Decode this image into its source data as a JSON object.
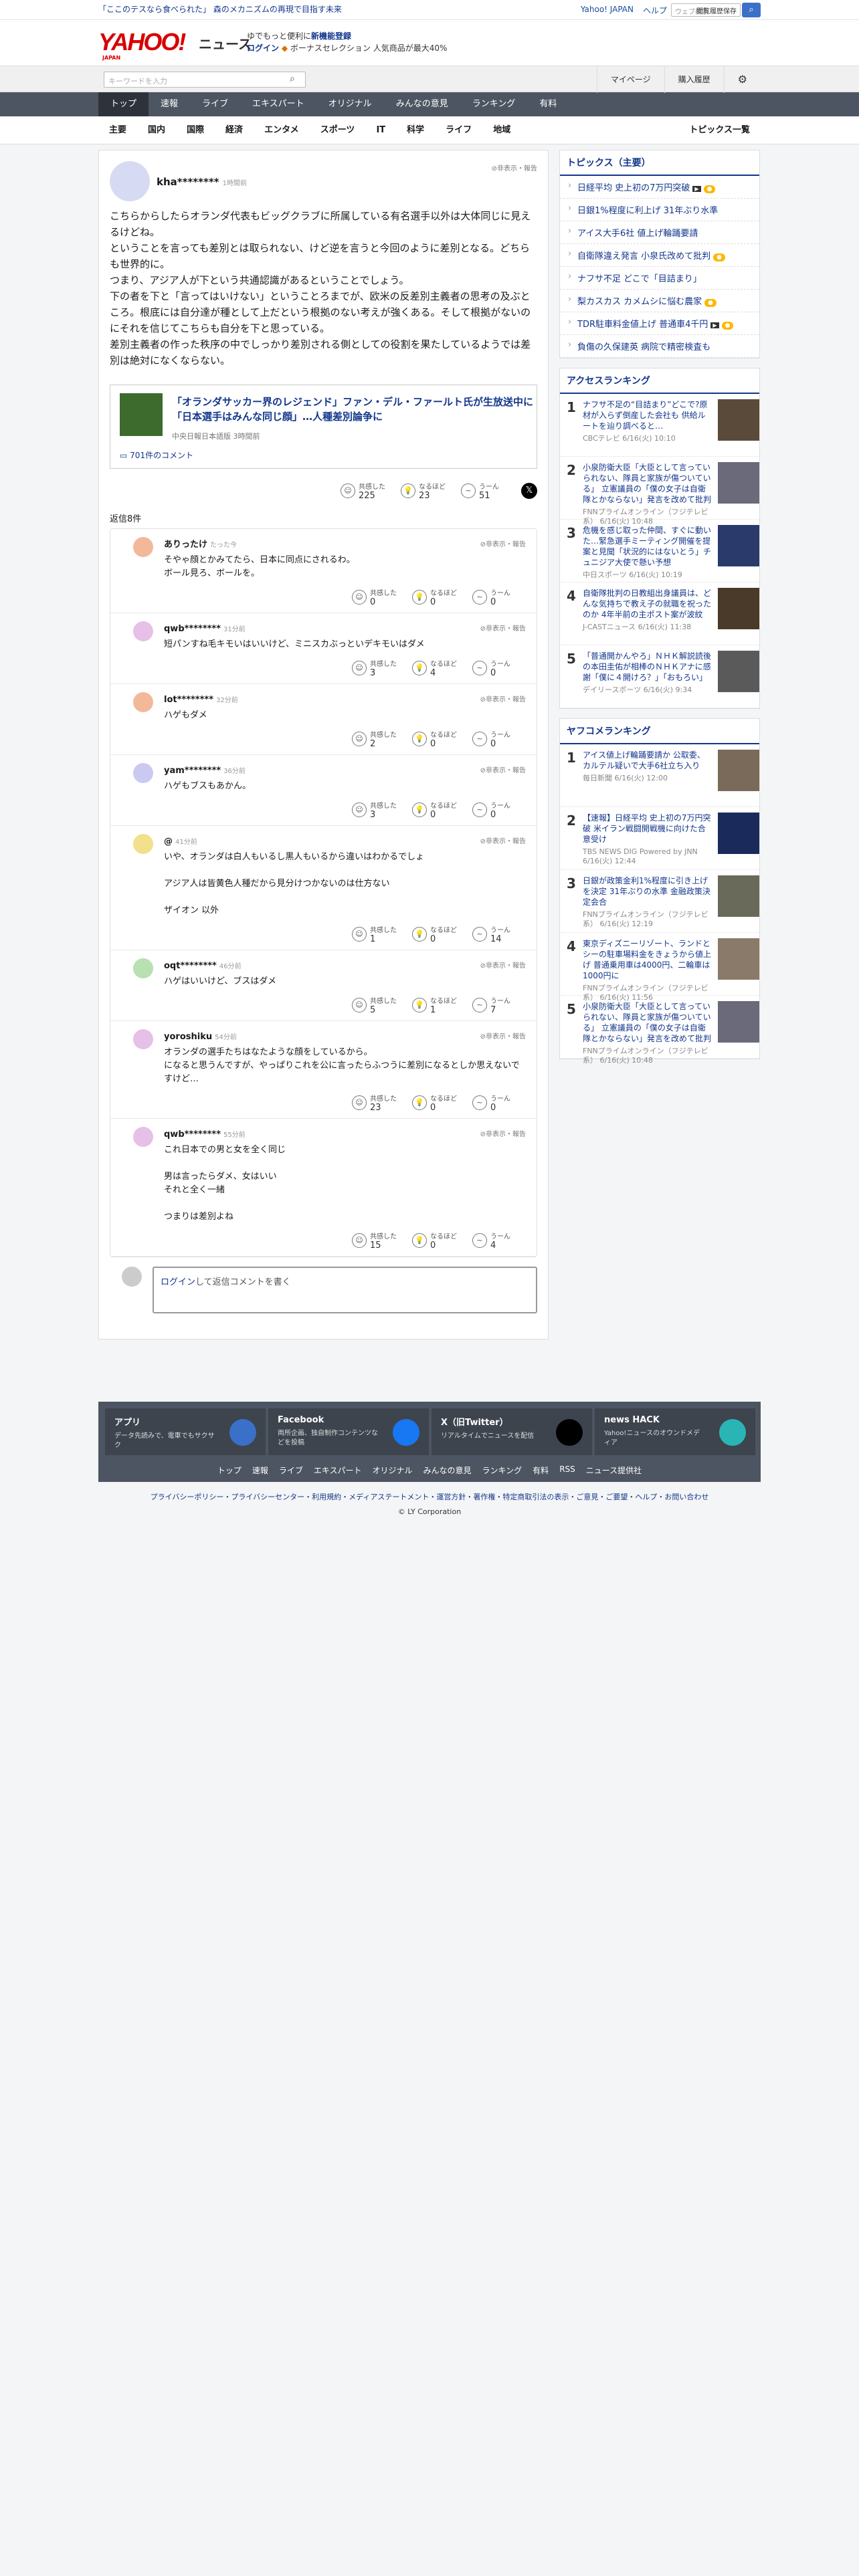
{
  "top": {
    "promo": "「ここのテスなら食べられた」 森のメカニズムの再現で目指す未来",
    "links": [
      "Yahoo! JAPAN",
      "ヘルプ"
    ],
    "search_placeholder": "ウェブ検索",
    "recent_save": "閲覧履歴保存"
  },
  "header": {
    "logo": "YAHOO!",
    "logo_sub": "JAPAN",
    "logo_news": "ニュース",
    "promo_line1": "ゆでもっと便利に",
    "promo_line1_bold": "新機能登録",
    "login": "ログイン",
    "promo_line2": "ボーナスセレクション  人気商品が最大40%"
  },
  "searchbar": {
    "placeholder": "キーワードを入力",
    "mypage": "マイページ",
    "history": "購入履歴"
  },
  "nav1": [
    "トップ",
    "速報",
    "ライブ",
    "エキスパート",
    "オリジナル",
    "みんなの意見",
    "ランキング",
    "有料"
  ],
  "nav2": [
    "主要",
    "国内",
    "国際",
    "経済",
    "エンタメ",
    "スポーツ",
    "IT",
    "科学",
    "ライフ",
    "地域"
  ],
  "nav2_last": "トピックス一覧",
  "comment": {
    "user": "kha********",
    "time": "1時間前",
    "report": "非表示・報告",
    "body": [
      "こちらからしたらオランダ代表もビッグクラブに所属している有名選手以外は大体同じに見えるけどね。",
      "ということを言っても差別とは取られない、けど逆を言うと今回のように差別となる。どちらも世界的に。",
      "つまり、アジア人が下という共通認識があるということでしょう。",
      "下の者を下と「言ってはいけない」ということろまでが、欧米の反差別主義者の思考の及ぶところ。根底には自分達が種として上だという根拠のない考えが強くある。そして根拠がないのにそれを信じてこちらも自分を下と思っている。",
      "差別主義者の作った秩序の中でしっかり差別される側としての役割を果たしているようでは差別は絶対になくならない。"
    ],
    "article_title": "「オランダサッカー界のレジェンド」ファン・デル・ファールト氏が生放送中に「日本選手はみんな同じ顔」…人種差別論争に",
    "article_src": "中央日報日本語版 3時間前",
    "article_comments": "701件のコメント",
    "reactions": [
      {
        "label": "共感した",
        "value": "225",
        "icon": "smile-icon"
      },
      {
        "label": "なるほど",
        "value": "23",
        "icon": "lightbulb-icon"
      },
      {
        "label": "うーん",
        "value": "51",
        "icon": "hmm-icon"
      }
    ],
    "reply_label": "返信8件"
  },
  "replies": [
    {
      "user": "ありったけ",
      "time": "たった今",
      "color": "#f3b89a",
      "lines": [
        "そやゃ顔とかみてたら、日本に同点にされるわ。",
        "ボール見ろ、ボールを。"
      ],
      "r": [
        "0",
        "0",
        "0"
      ]
    },
    {
      "user": "qwb********",
      "time": "31分前",
      "color": "#e6c0e6",
      "lines": [
        "短パンすね毛キモいはいいけど、ミニスカぶっといデキモいはダメ"
      ],
      "r": [
        "3",
        "4",
        "0"
      ]
    },
    {
      "user": "lot********",
      "time": "32分前",
      "color": "#f3b89a",
      "lines": [
        "ハゲもダメ"
      ],
      "r": [
        "2",
        "0",
        "0"
      ]
    },
    {
      "user": "yam********",
      "time": "36分前",
      "color": "#c9c9f2",
      "lines": [
        "ハゲもブスもあかん。"
      ],
      "r": [
        "3",
        "0",
        "0"
      ]
    },
    {
      "user": "@",
      "time": "41分前",
      "color": "#f2e08a",
      "lines": [
        "いや、オランダは白人もいるし黒人もいるから違いはわかるでしょ",
        "",
        "アジア人は皆黄色人種だから見分けつかないのは仕方ない",
        "",
        "ザイオン 以外"
      ],
      "r": [
        "1",
        "0",
        "14"
      ]
    },
    {
      "user": "oqt********",
      "time": "46分前",
      "color": "#b8e0b0",
      "lines": [
        "ハゲはいいけど、ブスはダメ"
      ],
      "r": [
        "5",
        "1",
        "7"
      ]
    },
    {
      "user": "yoroshiku",
      "time": "54分前",
      "color": "#e6c0e6",
      "lines": [
        "オランダの選手たちはなたような顔をしているから。",
        "になると思うんですが、やっぱりこれを公に言ったらふつうに差別になるとしか思えないですけど…"
      ],
      "r": [
        "23",
        "0",
        "0"
      ]
    },
    {
      "user": "qwb********",
      "time": "55分前",
      "color": "#e6c0e6",
      "lines": [
        "これ日本での男と女を全く同じ",
        "",
        "男は言ったらダメ、女はいい",
        "それと全く一緒",
        "",
        "つまりは差別よね"
      ],
      "r": [
        "15",
        "0",
        "4"
      ]
    }
  ],
  "reply_box": {
    "login": "ログイン",
    "text": "して返信コメントを書く"
  },
  "topics": {
    "heading": "トピックス（主要）",
    "items": [
      {
        "t": "日経平均 史上初の7万円突破",
        "v": true,
        "n": true
      },
      {
        "t": "日銀1%程度に利上げ 31年ぶり水準",
        "v": false,
        "n": false
      },
      {
        "t": "アイス大手6社 値上げ輪踊要請",
        "v": false,
        "n": false
      },
      {
        "t": "自衛隊違え発言 小泉氏改めて批判",
        "v": false,
        "n": true
      },
      {
        "t": "ナフサ不足 どこで「目詰まり」",
        "v": false,
        "n": false
      },
      {
        "t": "梨カスカス カメムシに悩む農家",
        "v": false,
        "n": true
      },
      {
        "t": "TDR駐車料金値上げ 普通車4千円",
        "v": true,
        "n": true
      },
      {
        "t": "負傷の久保建英 病院で精密検査も",
        "v": false,
        "n": false
      }
    ]
  },
  "access_ranking": {
    "heading": "アクセスランキング",
    "items": [
      {
        "t": "ナフサ不足の“目詰まり”どこで?原材が入らず倒産した会社も 供給ルートを辿り調べると…",
        "s": "CBCテレビ 6/16(火) 10:10",
        "c": "#5a4a3a"
      },
      {
        "t": "小泉防衛大臣「大臣として言っていられない、隊員と家族が傷ついている」 立憲議員の「僕の女子は自衛隊とかならない」発言を改めて批判",
        "s": "FNNプライムオンライン（フジテレビ系） 6/16(火) 10:48",
        "c": "#6a6a7a"
      },
      {
        "t": "危機を感じ取った仲間、すぐに動いた…緊急選手ミーティング開催を提案と見聞「状況的にはないとう」チュニジア大使で懸い予想",
        "s": "中日スポーツ 6/16(火) 10:19",
        "c": "#2a3a6a"
      },
      {
        "t": "自衛隊批判の日教組出身議員は、どんな気持ちで教え子の就職を祝ったのか 4年半前の主ポスト案が波紋",
        "s": "J-CASTニュース 6/16(火) 11:38",
        "c": "#4a3a2a"
      },
      {
        "t": "「普通開かんやろ」ＮＨＫ解説読後の本田圭佑が相棒のＮＨＫアナに感謝「僕に４開けろ？」「おもろい」",
        "s": "デイリースポーツ 6/16(火) 9:34",
        "c": "#5a5a5a"
      }
    ]
  },
  "yafoko_ranking": {
    "heading": "ヤフコメランキング",
    "items": [
      {
        "t": "アイス値上げ輪踊要請か 公取委、カルテル疑いで大手6社立ち入り",
        "s": "毎日新聞 6/16(火) 12:00",
        "c": "#7a6a5a"
      },
      {
        "t": "【速報】日経平均 史上初の7万円突破 米イラン戦闘開戦機に向けた合意受け",
        "s": "TBS NEWS DIG Powered by JNN 6/16(火) 12:44",
        "c": "#1a2a5a"
      },
      {
        "t": "日銀が政策金利1%程度に引き上げを決定 31年ぶりの水準 金融政策決定会合",
        "s": "FNNプライムオンライン（フジテレビ系） 6/16(火) 12:19",
        "c": "#6a6a5a"
      },
      {
        "t": "東京ディズニーリゾート、ランドとシーの駐車場料金をきょうから値上げ 普通乗用車は4000円、二輪車は1000円に",
        "s": "FNNプライムオンライン（フジテレビ系） 6/16(火) 11:56",
        "c": "#8a7a6a"
      },
      {
        "t": "小泉防衛大臣「大臣として言っていられない、隊員と家族が傷ついている」 立憲議員の「僕の女子は自衛隊とかならない」発言を改めて批判",
        "s": "FNNプライムオンライン（フジテレビ系） 6/16(火) 10:48",
        "c": "#6a6a7a"
      }
    ]
  },
  "footer": {
    "cols": [
      {
        "t": "アプリ",
        "d": "データ先読みで、電車でもサクサク",
        "c": "#3b70c9"
      },
      {
        "t": "Facebook",
        "d": "両所企画、独自制作コンテンツなどを投稿",
        "c": "#1877f2"
      },
      {
        "t": "X（旧Twitter）",
        "d": "リアルタイムでニュースを配信",
        "c": "#000000"
      },
      {
        "t": "news HACK",
        "d": "Yahoo!ニュースのオウンドメディア",
        "c": "#2ab5b5"
      }
    ],
    "links": [
      "トップ",
      "速報",
      "ライブ",
      "エキスパート",
      "オリジナル",
      "みんなの意見",
      "ランキング",
      "有料",
      "RSS",
      "ニュース提供社"
    ],
    "bottom": "プライバシーポリシー・プライバシーセンター・利用規約・メディアステートメント・運営方針・著作権・特定商取引法の表示・ご意見・ご要望・ヘルプ・お問い合わせ",
    "copyright": "© LY Corporation"
  }
}
